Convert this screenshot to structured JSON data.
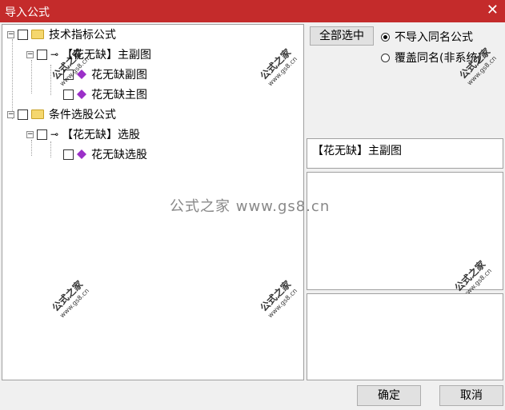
{
  "window": {
    "title": "导入公式",
    "close_glyph": "✕"
  },
  "tree": {
    "nodes": [
      {
        "label": "技术指标公式",
        "kind": "folder"
      },
      {
        "label": "【花无缺】主副图",
        "kind": "key"
      },
      {
        "label": "花无缺副图",
        "kind": "gem"
      },
      {
        "label": "花无缺主图",
        "kind": "gem"
      },
      {
        "label": "条件选股公式",
        "kind": "folder"
      },
      {
        "label": "【花无缺】选股",
        "kind": "key"
      },
      {
        "label": "花无缺选股",
        "kind": "gem"
      }
    ]
  },
  "actions": {
    "select_all": "全部选中",
    "radio_skip": "不导入同名公式",
    "radio_overwrite": "覆盖同名(非系统)",
    "ok": "确定",
    "cancel": "取消"
  },
  "description": "【花无缺】主副图",
  "watermark": {
    "name": "公式之家",
    "url": "www.gs8.cn",
    "center": "公式之家 www.gs8.cn"
  },
  "colors": {
    "titlebar": "#c42b2b",
    "gem": "#9b30c8",
    "folder": "#f5d76e"
  }
}
